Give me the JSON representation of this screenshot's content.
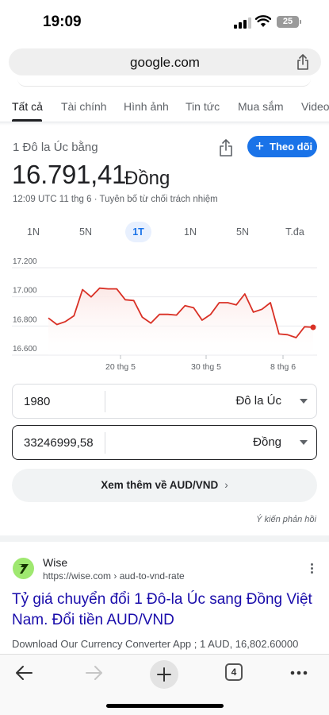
{
  "status": {
    "time": "19:09",
    "battery": "25"
  },
  "browser": {
    "url": "google.com",
    "tabs_count": "4"
  },
  "search_tabs": [
    "Tất cả",
    "Tài chính",
    "Hình ảnh",
    "Tin tức",
    "Mua sắm",
    "Video"
  ],
  "currency": {
    "subtitle": "1 Đô la Úc bằng",
    "value": "16.791,41",
    "unit": "Đồng",
    "timestamp": "12:09 UTC 11 thg 6 · Tuyên bố từ chối trách nhiệm",
    "follow_label": "Theo dõi",
    "ranges": [
      "1N",
      "5N",
      "1T",
      "1N",
      "5N",
      "T.đa"
    ],
    "active_range": "1T"
  },
  "chart_data": {
    "type": "area",
    "ylim": [
      16600,
      17200
    ],
    "yticks": [
      "17.200",
      "17.000",
      "16.800",
      "16.600"
    ],
    "xticks": [
      "20 thg 5",
      "30 thg 5",
      "8 thg 6"
    ],
    "values": [
      16855,
      16810,
      16830,
      16870,
      17050,
      17000,
      17060,
      17055,
      17055,
      16980,
      16975,
      16860,
      16820,
      16880,
      16880,
      16875,
      16940,
      16925,
      16840,
      16880,
      16960,
      16960,
      16945,
      17020,
      16895,
      16915,
      16960,
      16745,
      16740,
      16720,
      16795,
      16791
    ],
    "line_color": "#d93025",
    "fill_color": "#fce8e6"
  },
  "converter": {
    "from_amount": "1980",
    "from_unit": "Đô la Úc",
    "to_amount": "33246999,58",
    "to_unit": "Đồng"
  },
  "more_label": "Xem thêm về AUD/VND",
  "feedback_label": "Ý kiến phản hồi",
  "result": {
    "site": "Wise",
    "url": "https://wise.com › aud-to-vnd-rate",
    "title": "Tỷ giá chuyển đổi 1 Đô-la Úc sang Đồng Việt Nam. Đổi tiền AUD/VND",
    "snippet": "Download Our Currency Converter App ; 1 AUD, 16,802.60000"
  }
}
